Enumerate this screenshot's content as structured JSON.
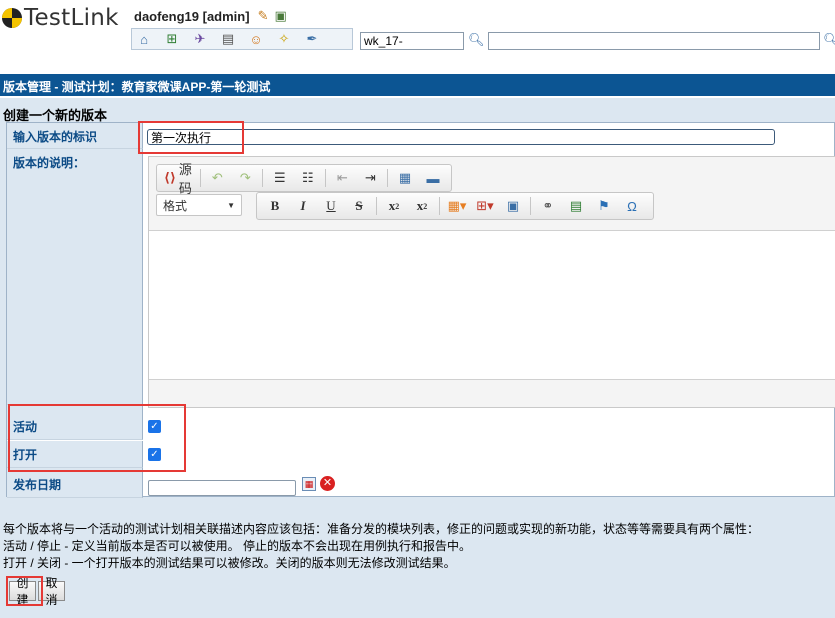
{
  "header": {
    "logo_text": "TestLink",
    "user": "daofeng19 [admin]",
    "build_input_value": "wk_17-",
    "search_value": ""
  },
  "titlebar": {
    "text": "版本管理 - 测试计划：教育家微课APP-第一轮测试"
  },
  "form": {
    "heading": "创建一个新的版本",
    "id_label": "输入版本的标识",
    "id_value": "第一次执行",
    "desc_label": "版本的说明：",
    "active_label": "活动",
    "open_label": "打开",
    "date_label": "发布日期",
    "date_value": "",
    "active_checked": true,
    "open_checked": true
  },
  "editor": {
    "source_label": "源码",
    "format_label": "格式"
  },
  "info": {
    "line1": "每个版本将与一个活动的测试计划相关联描述内容应该包括：准备分发的模块列表，修正的问题或实现的新功能，状态等等需要具有两个属性：",
    "line2": "活动 / 停止 - 定义当前版本是否可以被使用。 停止的版本不会出现在用例执行和报告中。",
    "line3": "打开 / 关闭 - 一个打开版本的测试结果可以被修改。关闭的版本则无法修改测试结果。"
  },
  "buttons": {
    "create": "创建",
    "cancel": "取消"
  },
  "colors": {
    "titlebar": "#0c5593",
    "panel": "#dce7f1",
    "label_text": "#0c4b86",
    "annotation": "#e53935"
  }
}
